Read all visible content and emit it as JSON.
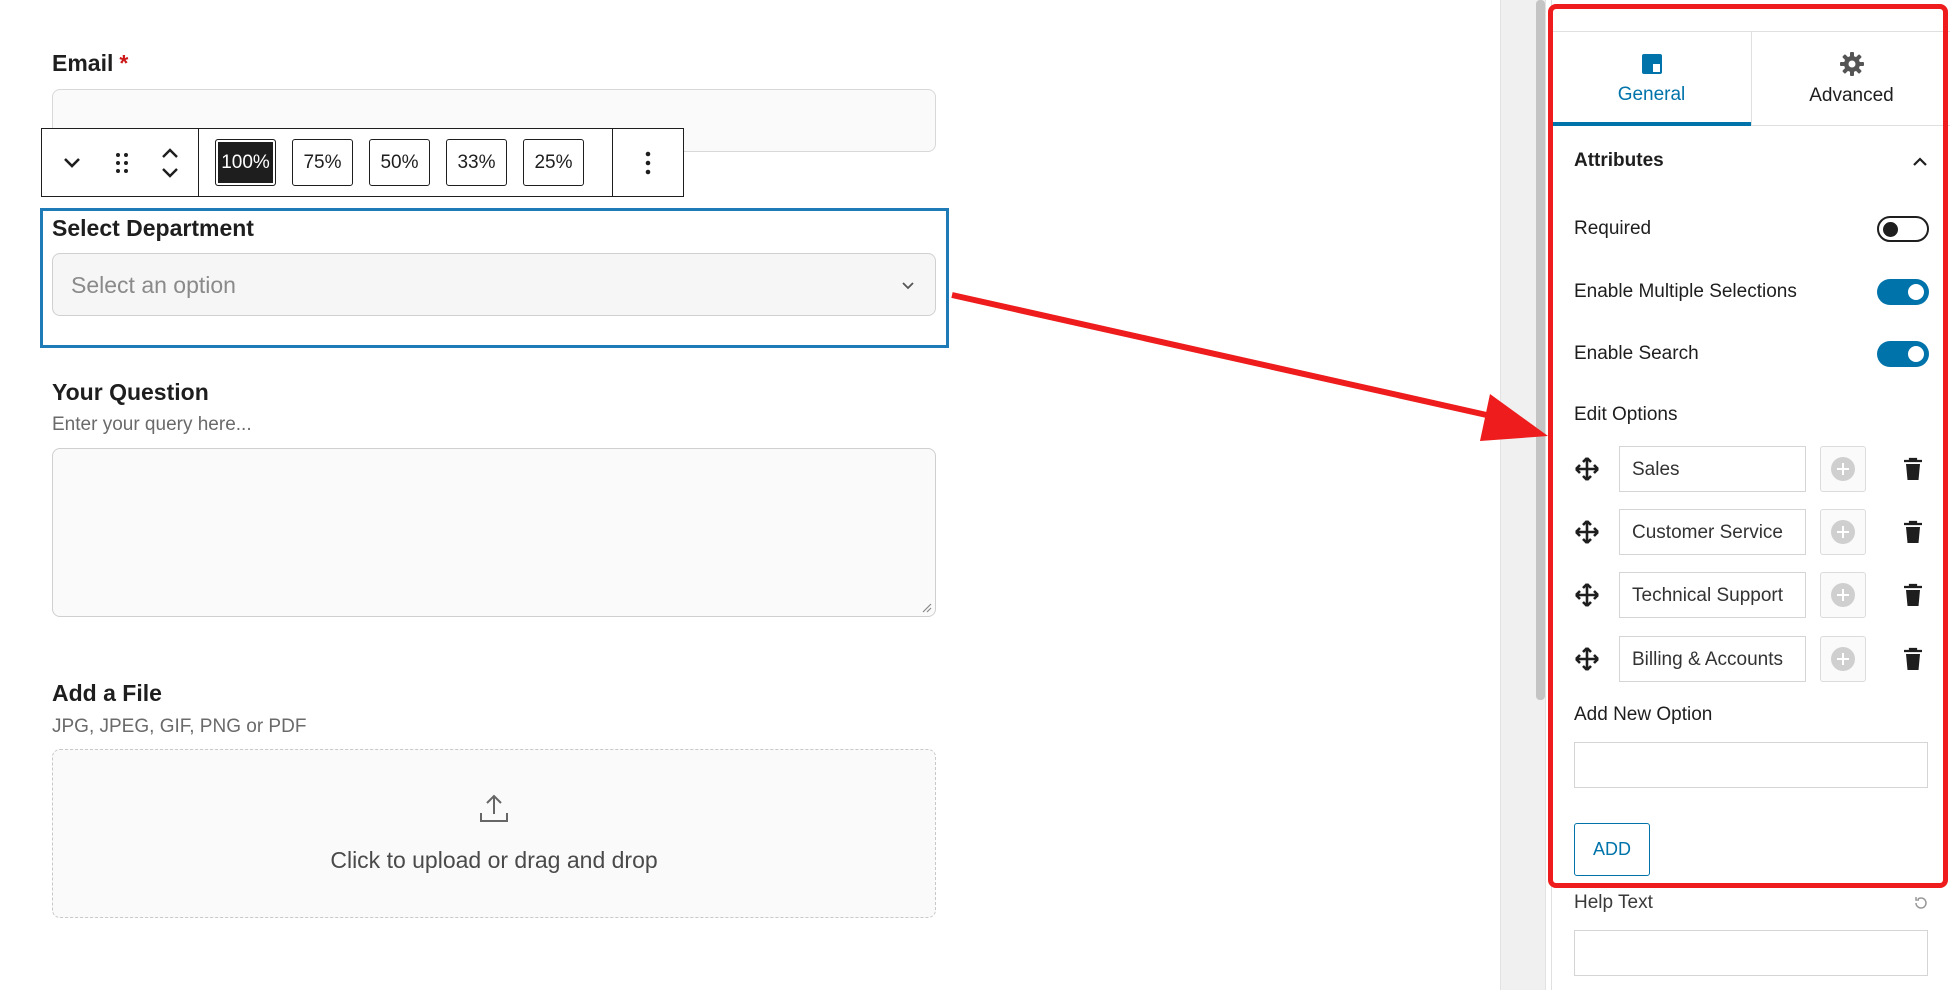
{
  "form": {
    "email_label": "Email",
    "email_required_mark": "*",
    "department_label": "Select Department",
    "department_placeholder": "Select an option",
    "question_label": "Your Question",
    "question_help": "Enter your query here...",
    "file_label": "Add a File",
    "file_help": "JPG, JPEG, GIF, PNG or PDF",
    "upload_text": "Click to upload or drag and drop"
  },
  "toolbar": {
    "widths": [
      "100%",
      "75%",
      "50%",
      "33%",
      "25%"
    ],
    "active_width": "100%"
  },
  "sidebar": {
    "tabs": [
      {
        "label": "General",
        "icon": "block-layout-icon",
        "active": true
      },
      {
        "label": "Advanced",
        "icon": "gear-icon",
        "active": false
      }
    ],
    "panel_title": "Attributes",
    "required_label": "Required",
    "required_on": false,
    "multiple_label": "Enable Multiple Selections",
    "multiple_on": true,
    "search_label": "Enable Search",
    "search_on": true,
    "edit_options_label": "Edit Options",
    "options": [
      "Sales",
      "Customer Service",
      "Technical Support",
      "Billing & Accounts"
    ],
    "add_new_label": "Add New Option",
    "add_button": "ADD",
    "help_text_label": "Help Text"
  },
  "colors": {
    "accent": "#0073aa",
    "selection_border": "#1f7bb8",
    "annotation_red": "#ee1c1c",
    "required_red": "#cc1818"
  }
}
